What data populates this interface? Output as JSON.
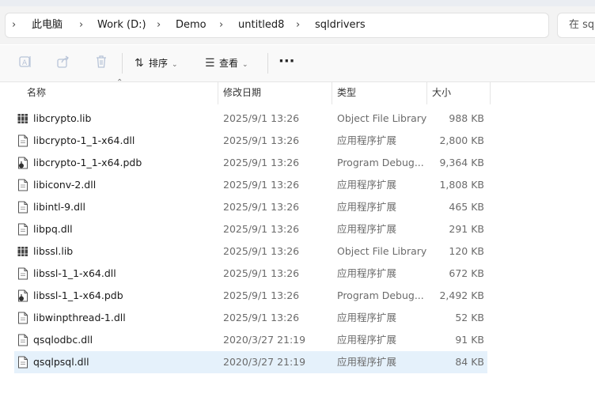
{
  "breadcrumb": {
    "items": [
      "此电脑",
      "Work (D:)",
      "Demo",
      "untitled8",
      "sqldrivers"
    ]
  },
  "search": {
    "placeholder": "在 sq"
  },
  "toolbar": {
    "sort_label": "排序",
    "view_label": "查看",
    "more_label": "···"
  },
  "columns": {
    "name": "名称",
    "date": "修改日期",
    "type": "类型",
    "size": "大小"
  },
  "files": [
    {
      "name": "libcrypto.lib",
      "date": "2025/9/1 13:26",
      "type": "Object File Library",
      "size": "988 KB",
      "icon": "library-icon"
    },
    {
      "name": "libcrypto-1_1-x64.dll",
      "date": "2025/9/1 13:26",
      "type": "应用程序扩展",
      "size": "2,800 KB",
      "icon": "dll-file-icon"
    },
    {
      "name": "libcrypto-1_1-x64.pdb",
      "date": "2025/9/1 13:26",
      "type": "Program Debug...",
      "size": "9,364 KB",
      "icon": "pdb-file-icon"
    },
    {
      "name": "libiconv-2.dll",
      "date": "2025/9/1 13:26",
      "type": "应用程序扩展",
      "size": "1,808 KB",
      "icon": "dll-file-icon"
    },
    {
      "name": "libintl-9.dll",
      "date": "2025/9/1 13:26",
      "type": "应用程序扩展",
      "size": "465 KB",
      "icon": "dll-file-icon"
    },
    {
      "name": "libpq.dll",
      "date": "2025/9/1 13:26",
      "type": "应用程序扩展",
      "size": "291 KB",
      "icon": "dll-file-icon"
    },
    {
      "name": "libssl.lib",
      "date": "2025/9/1 13:26",
      "type": "Object File Library",
      "size": "120 KB",
      "icon": "library-icon"
    },
    {
      "name": "libssl-1_1-x64.dll",
      "date": "2025/9/1 13:26",
      "type": "应用程序扩展",
      "size": "672 KB",
      "icon": "dll-file-icon"
    },
    {
      "name": "libssl-1_1-x64.pdb",
      "date": "2025/9/1 13:26",
      "type": "Program Debug...",
      "size": "2,492 KB",
      "icon": "pdb-file-icon"
    },
    {
      "name": "libwinpthread-1.dll",
      "date": "2025/9/1 13:26",
      "type": "应用程序扩展",
      "size": "52 KB",
      "icon": "dll-file-icon"
    },
    {
      "name": "qsqlodbc.dll",
      "date": "2020/3/27 21:19",
      "type": "应用程序扩展",
      "size": "91 KB",
      "icon": "dll-file-icon"
    },
    {
      "name": "qsqlpsql.dll",
      "date": "2020/3/27 21:19",
      "type": "应用程序扩展",
      "size": "84 KB",
      "icon": "dll-file-icon",
      "selected": true
    }
  ],
  "colors": {
    "selection": "#e5f1fb",
    "disabled_icon": "#b8c4d8"
  }
}
